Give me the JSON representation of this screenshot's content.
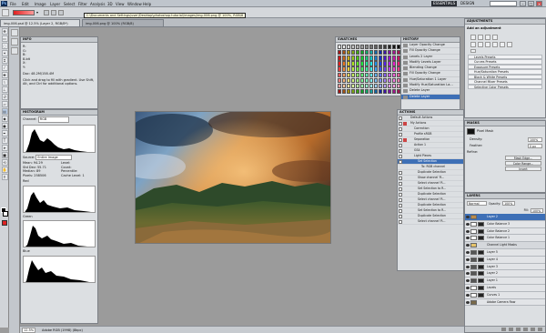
{
  "app": {
    "logo": "Ps"
  },
  "menu": [
    "File",
    "Edit",
    "Image",
    "Layer",
    "Select",
    "Filter",
    "Analysis",
    "3D",
    "View",
    "Window",
    "Help"
  ],
  "workspace": {
    "label": "ESSENTIALS",
    "alt_label": "DESIGN"
  },
  "tooltip": "C:\\Documents and Settings\\user\\Desktop\\photoshop-tutorial\\images\\img-006.png @ 100%, RGB/8",
  "tabs": [
    {
      "label": "img-006.psd @ 12.5% (Layer 2, RGB/8*)"
    },
    {
      "label": "img-006.png @ 100% (RGB/8)"
    }
  ],
  "info_panel": {
    "title": "INFO",
    "lines": [
      "R:",
      "G:",
      "B:",
      "8-bit",
      "X:",
      "Y:",
      "Doc: 48.2M/158.4M",
      "Click and drag to fill with gradient. Use Shift, Alt, and Ctrl for additional options."
    ]
  },
  "histogram_panel": {
    "title": "HISTOGRAM",
    "channel_label": "Channel:",
    "channel_value": "RGB",
    "source_label": "Source:",
    "source_value": "Entire Image",
    "stats": [
      "Mean: 94.29",
      "Level:",
      "Std Dev: 55.71",
      "Count:",
      "Median: 89",
      "Percentile:",
      "Pixels: 258506",
      "Cache Level: 1"
    ],
    "channel_names": [
      "Red",
      "Green",
      "Blue"
    ]
  },
  "swatches_panel": {
    "title": "SWATCHES"
  },
  "history_panel": {
    "title": "HISTORY",
    "items": [
      "Layer Opacity Change",
      "Fill Opacity Change",
      "Levels 2 Layer",
      "Modify Levels Layer",
      "Blending Change",
      "Fill Opacity Change",
      "Hue/Saturation 1 Layer",
      "Modify Hue/Saturation La...",
      "Delete Layer",
      "Delete Layer"
    ]
  },
  "actions_panel": {
    "title": "ACTIONS",
    "items": [
      "Default Actions",
      "My Actions",
      "Correction",
      "Profile sRGB",
      "Separation",
      "Action 1",
      "GS4",
      "Light Pieces",
      "Set Selection",
      "To: RGB channel",
      "Duplicate Selection",
      "Show channel 'R...",
      "Select channel 'R...",
      "Set Selection to R...",
      "Duplicate Selection",
      "Select channel 'R...",
      "Duplicate Selection",
      "Set Selection to R...",
      "Duplicate Selection",
      "Select channel 'R..."
    ]
  },
  "adjustments_panel": {
    "title": "ADJUSTMENTS",
    "subtitle": "Add an adjustment",
    "presets": [
      "Levels Presets",
      "Curves Presets",
      "Exposure Presets",
      "Hue/Saturation Presets",
      "Black & White Presets",
      "Channel Mixer Presets",
      "Selective Color Presets"
    ]
  },
  "masks_panel": {
    "title": "MASKS",
    "mask_label": "Pixel Mask",
    "density_label": "Density:",
    "density_value": "100%",
    "feather_label": "Feather:",
    "feather_value": "0 px",
    "refine_label": "Refine:",
    "buttons": [
      "Mask Edge...",
      "Color Range...",
      "Invert"
    ]
  },
  "layers_panel": {
    "title": "LAYERS",
    "blend_mode": "Normal",
    "opacity_label": "Opacity:",
    "opacity_value": "100%",
    "fill_label": "Fill:",
    "fill_value": "100%",
    "layers": [
      "Layer 2",
      "Color Balance 3",
      "Color Balance 2",
      "Color Balance 1",
      "Channel Light Masks",
      "Layer 5",
      "Layer 4",
      "Layer 3",
      "Layer 2",
      "Layer 1",
      "Levels",
      "Curves 1",
      "Adobe Camera Raw"
    ]
  },
  "status_bar": {
    "zoom": "12.5%",
    "doc_info": "Adobe RGB (1998) (8bpc)"
  },
  "colors": {
    "accent": "#3d6fb6",
    "workspace_bg": "#9b9b9b",
    "panel_bg": "#dcdfe2"
  }
}
